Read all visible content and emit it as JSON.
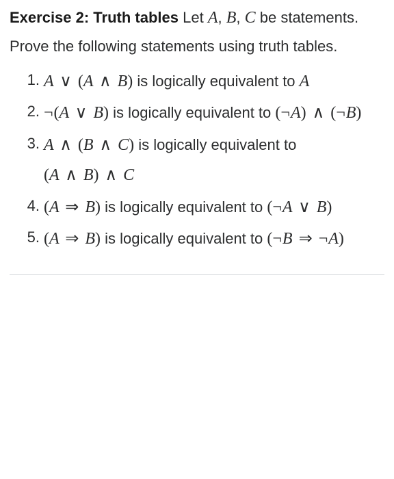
{
  "header": {
    "title": "Exercise 2: Truth tables",
    "intro_before_vars": " Let ",
    "var_A": "A",
    "comma1": ", ",
    "var_B": "B",
    "comma2": ", ",
    "var_C": "C",
    "intro_after_vars": " be statements. Prove the following statements using truth tables."
  },
  "equiv_text": " is logically equivalent to ",
  "items": [
    {
      "num": "1.",
      "lhs": "A ∨ (A ∧ B)",
      "rhs": "A"
    },
    {
      "num": "2.",
      "lhs": "¬(A ∨ B)",
      "rhs": "(¬A) ∧ (¬B)"
    },
    {
      "num": "3.",
      "lhs": "A ∧ (B ∧ C)",
      "rhs": "(A ∧ B) ∧ C"
    },
    {
      "num": "4.",
      "lhs": "(A ⇒ B)",
      "rhs": "(¬A ∨ B)"
    },
    {
      "num": "5.",
      "lhs": "(A ⇒ B)",
      "rhs": "(¬B ⇒ ¬A)"
    }
  ]
}
